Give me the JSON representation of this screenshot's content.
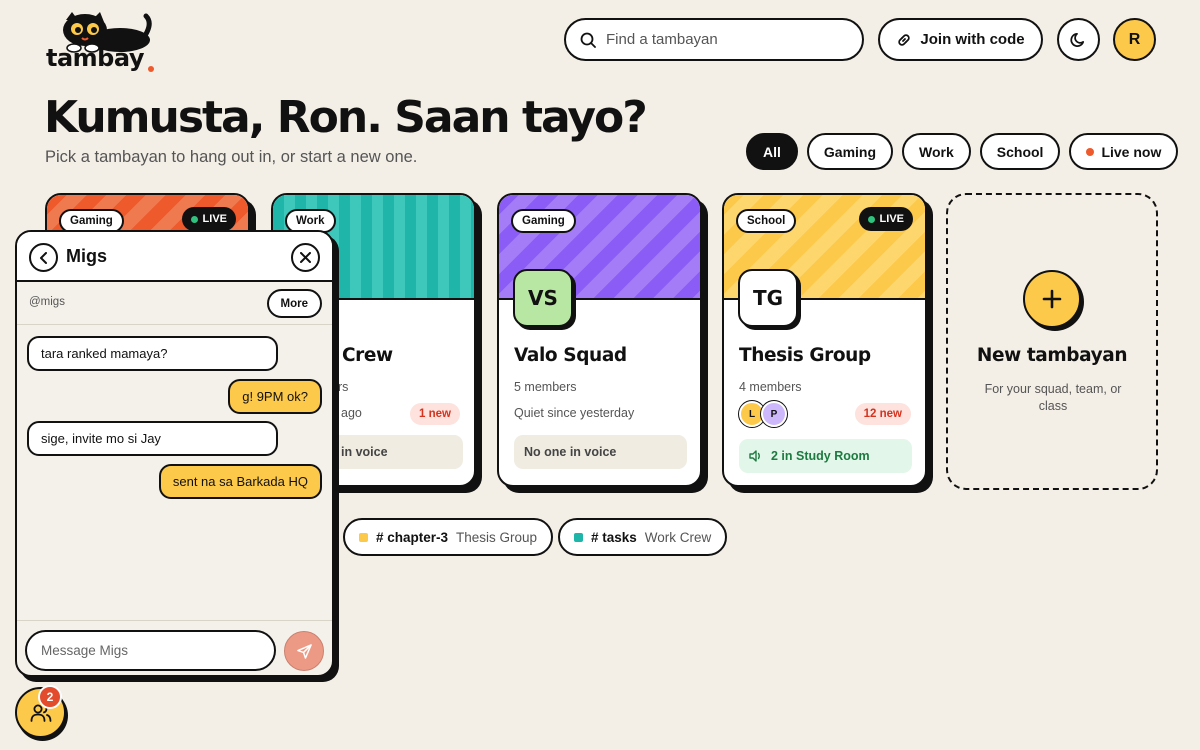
{
  "app": {
    "logo_text": "tambay"
  },
  "header": {
    "search_placeholder": "Find a tambayan",
    "join_label": "Join with code",
    "avatar_initial": "R"
  },
  "hero": {
    "greeting": "Kumusta, Ron. Saan tayo?",
    "subtitle": "Pick a tambayan to hang out in, or start a new one."
  },
  "filters": [
    "All",
    "Gaming",
    "Work",
    "School",
    "Live now"
  ],
  "cards": [
    {
      "tag": "Gaming",
      "live": "LIVE"
    },
    {
      "tag": "Work",
      "title": "Crew",
      "members": "ers",
      "status": "ago",
      "new": "1 new",
      "voice": "in voice"
    },
    {
      "tag": "Gaming",
      "initials": "VS",
      "title": "Valo Squad",
      "members": "5 members",
      "status": "Quiet since yesterday",
      "voice": "No one in voice"
    },
    {
      "tag": "School",
      "live": "LIVE",
      "initials": "TG",
      "title": "Thesis Group",
      "members": "4 members",
      "avatars": [
        "L",
        "P"
      ],
      "new": "12 new",
      "voice": "2 in Study Room"
    }
  ],
  "new_card": {
    "title": "New tambayan",
    "subtitle": "For your squad, team, or class"
  },
  "channels": [
    {
      "channel": "# chapter-3",
      "group": "Thesis Group",
      "color": "#fdc94a"
    },
    {
      "channel": "# tasks",
      "group": "Work Crew",
      "color": "#1fb5a8"
    }
  ],
  "dm": {
    "name": "Migs",
    "handle": "@migs",
    "more_label": "More",
    "messages": [
      {
        "from": "them",
        "text": "tara ranked mamaya?"
      },
      {
        "from": "me",
        "text": "g! 9PM ok?"
      },
      {
        "from": "them",
        "text": "sige, invite mo si Jay"
      },
      {
        "from": "me",
        "text": "sent na sa Barkada HQ"
      }
    ],
    "input_placeholder": "Message Migs"
  },
  "friends": {
    "badge": "2"
  },
  "colors": {
    "orange": "#ee5a2c",
    "teal": "#1fb5a8",
    "purple": "#8b5cf6",
    "yellow": "#fdc94a",
    "live": "#2ec27e"
  }
}
